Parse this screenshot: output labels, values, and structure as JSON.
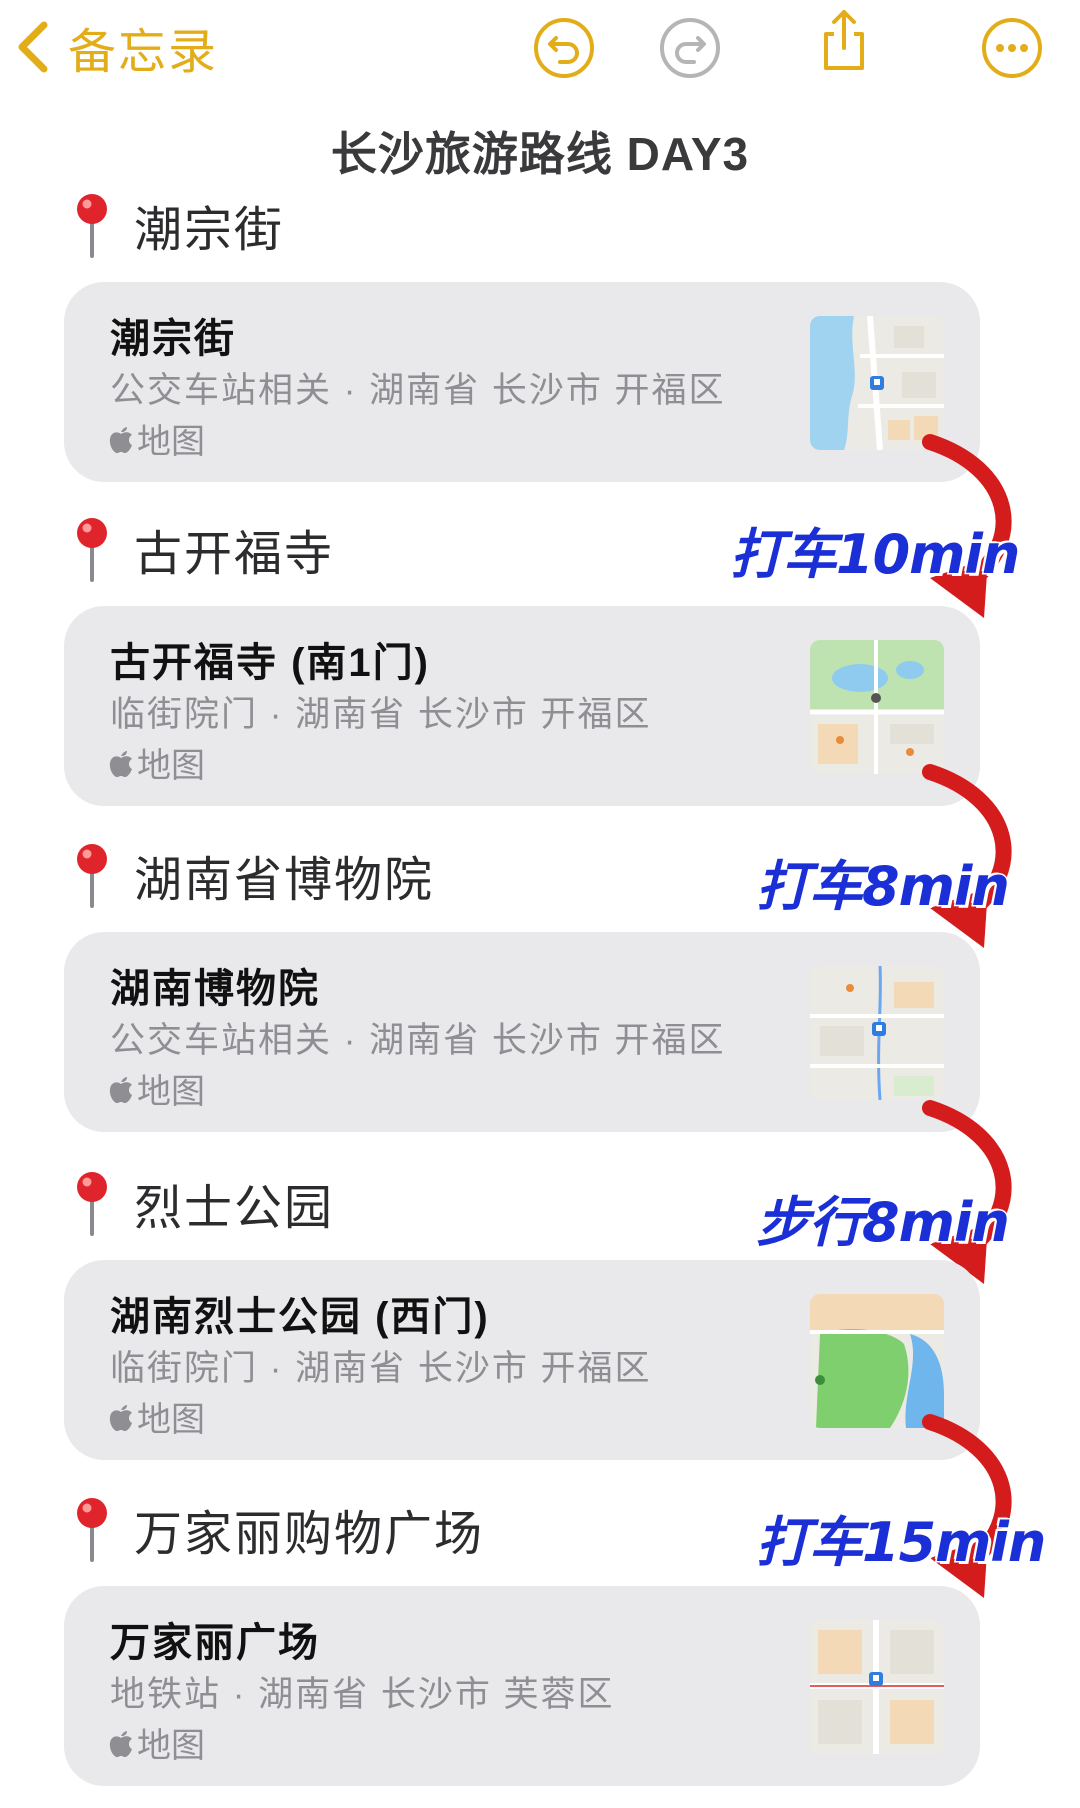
{
  "nav": {
    "back_label": "备忘录",
    "accent": "#e3ad1a",
    "disabled": "#b5b5b8",
    "icons": [
      "chevron-left-icon",
      "undo-icon",
      "redo-icon",
      "share-icon",
      "more-icon"
    ]
  },
  "note": {
    "title": "长沙旅游路线 DAY3"
  },
  "apple_maps_label": "地图",
  "stops": [
    {
      "heading": "潮宗街",
      "card_title": "潮宗街",
      "card_sub": "公交车站相关 · 湖南省 长沙市 开福区"
    },
    {
      "heading": "古开福寺",
      "card_title": "古开福寺 (南1门)",
      "card_sub": "临街院门 · 湖南省 长沙市 开福区"
    },
    {
      "heading": "湖南省博物院",
      "card_title": "湖南博物院",
      "card_sub": "公交车站相关 · 湖南省 长沙市 开福区"
    },
    {
      "heading": "烈士公园",
      "card_title": "湖南烈士公园 (西门)",
      "card_sub": "临街院门 · 湖南省 长沙市 开福区"
    },
    {
      "heading": "万家丽购物广场",
      "card_title": "万家丽广场",
      "card_sub": "地铁站 · 湖南省 长沙市 芙蓉区"
    }
  ],
  "legs": [
    {
      "label": "打车10min"
    },
    {
      "label": "打车8min"
    },
    {
      "label": "步行8min"
    },
    {
      "label": "打车15min"
    }
  ],
  "colors": {
    "card_bg": "#e9e9ec",
    "arrow": "#d41c1c",
    "travel_text": "#1b2fd6"
  }
}
